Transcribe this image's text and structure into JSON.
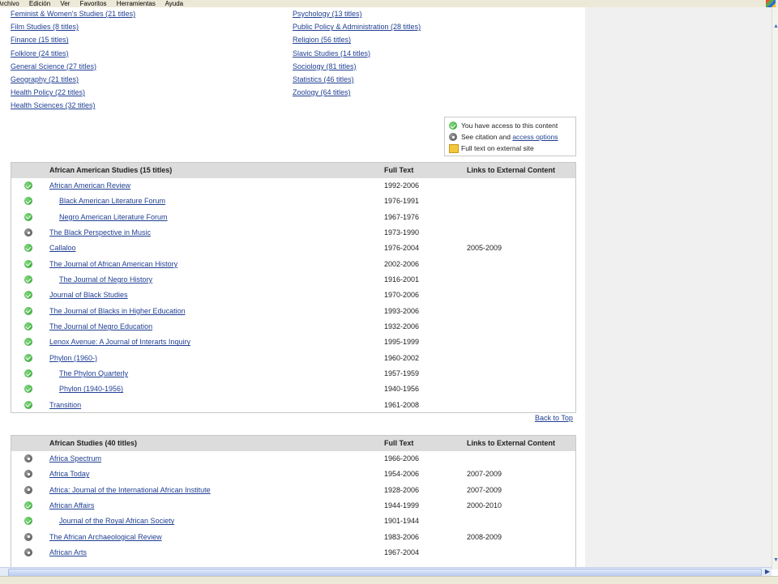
{
  "menubar": {
    "items": [
      "Archivo",
      "Edición",
      "Ver",
      "Favoritos",
      "Herramientas",
      "Ayuda"
    ]
  },
  "subjects": {
    "left": [
      "Feminist & Women's Studies (21 titles)",
      "Film Studies (8 titles)",
      "Finance (15 titles)",
      "Folklore (24 titles)",
      "General Science (27 titles)",
      "Geography (21 titles)",
      "Health Policy (22 titles)",
      "Health Sciences (32 titles)"
    ],
    "right": [
      "Psychology (13 titles)",
      "Public Policy & Administration (28 titles)",
      "Religion (56 titles)",
      "Slavic Studies (14 titles)",
      "Sociology (81 titles)",
      "Statistics (46 titles)",
      "Zoology (64 titles)"
    ]
  },
  "legend": {
    "access": "You have access to this content",
    "citation_prefix": "See citation and ",
    "citation_link": "access options",
    "external": "Full text on external site"
  },
  "columns": {
    "full_text": "Full Text",
    "external": "Links to External Content"
  },
  "tables": [
    {
      "title": "African American Studies (15 titles)",
      "rows": [
        {
          "icon": "check-icon",
          "title": "African American Review",
          "full": "1992-2006",
          "ext": "",
          "indent": false
        },
        {
          "icon": "check-icon",
          "title": "Black American Literature Forum",
          "full": "1976-1991",
          "ext": "",
          "indent": true
        },
        {
          "icon": "check-icon",
          "title": "Negro American Literature Forum",
          "full": "1967-1976",
          "ext": "",
          "indent": true
        },
        {
          "icon": "lock-icon",
          "title": "The Black Perspective in Music",
          "full": "1973-1990",
          "ext": "",
          "indent": false
        },
        {
          "icon": "check-icon",
          "title": "Callaloo",
          "full": "1976-2004",
          "ext": "2005-2009",
          "indent": false
        },
        {
          "icon": "check-icon",
          "title": "The Journal of African American History",
          "full": "2002-2006",
          "ext": "",
          "indent": false
        },
        {
          "icon": "check-icon",
          "title": "The Journal of Negro History",
          "full": "1916-2001",
          "ext": "",
          "indent": true
        },
        {
          "icon": "check-icon",
          "title": "Journal of Black Studies",
          "full": "1970-2006",
          "ext": "",
          "indent": false
        },
        {
          "icon": "check-icon",
          "title": "The Journal of Blacks in Higher Education",
          "full": "1993-2006",
          "ext": "",
          "indent": false
        },
        {
          "icon": "check-icon",
          "title": "The Journal of Negro Education",
          "full": "1932-2006",
          "ext": "",
          "indent": false
        },
        {
          "icon": "check-icon",
          "title": "Lenox Avenue: A Journal of Interarts Inquiry",
          "full": "1995-1999",
          "ext": "",
          "indent": false
        },
        {
          "icon": "check-icon",
          "title": "Phylon (1960-)",
          "full": "1960-2002",
          "ext": "",
          "indent": false
        },
        {
          "icon": "check-icon",
          "title": "The Phylon Quarterly",
          "full": "1957-1959",
          "ext": "",
          "indent": true
        },
        {
          "icon": "check-icon",
          "title": "Phylon (1940-1956)",
          "full": "1940-1956",
          "ext": "",
          "indent": true
        },
        {
          "icon": "check-icon",
          "title": "Transition",
          "full": "1961-2008",
          "ext": "",
          "indent": false
        }
      ]
    },
    {
      "title": "African Studies (40 titles)",
      "rows": [
        {
          "icon": "lock-icon",
          "title": "Africa Spectrum",
          "full": "1966-2006",
          "ext": "",
          "indent": false
        },
        {
          "icon": "lock-icon",
          "title": "Africa Today",
          "full": "1954-2006",
          "ext": "2007-2009",
          "indent": false
        },
        {
          "icon": "lock-icon",
          "title": "Africa: Journal of the International African Institute",
          "full": "1928-2006",
          "ext": "2007-2009",
          "indent": false
        },
        {
          "icon": "check-icon",
          "title": "African Affairs",
          "full": "1944-1999",
          "ext": "2000-2010",
          "indent": false
        },
        {
          "icon": "check-icon",
          "title": "Journal of the Royal African Society",
          "full": "1901-1944",
          "ext": "",
          "indent": true
        },
        {
          "icon": "lock-icon",
          "title": "The African Archaeological Review",
          "full": "1983-2006",
          "ext": "2008-2009",
          "indent": false
        },
        {
          "icon": "lock-icon",
          "title": "African Arts",
          "full": "1967-2004",
          "ext": "",
          "indent": false
        }
      ]
    }
  ],
  "back_to_top": "Back to Top"
}
